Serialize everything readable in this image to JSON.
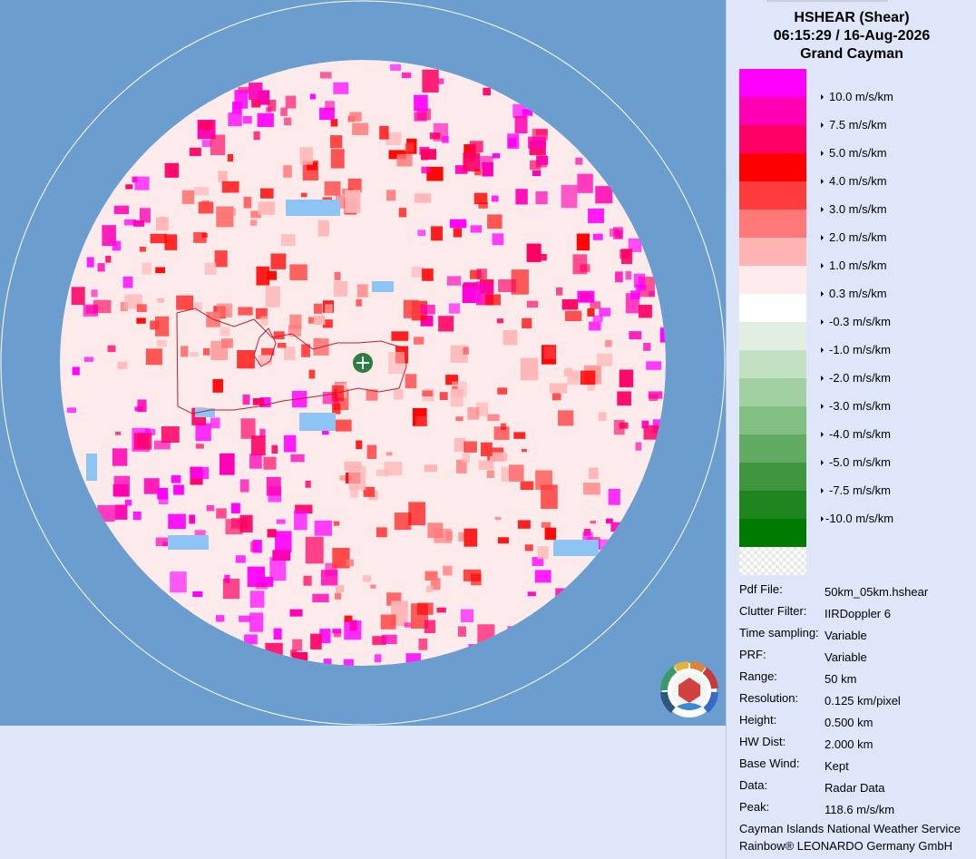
{
  "header": {
    "product": "HSHEAR (Shear)",
    "datetime": "06:15:29 / 16-Aug-2026",
    "site": "Grand Cayman"
  },
  "legend": [
    {
      "label": "10.0 m/s/km",
      "color": "#ff00ff"
    },
    {
      "label": "7.5 m/s/km",
      "color": "#ff00b4"
    },
    {
      "label": "5.0 m/s/km",
      "color": "#ff0064"
    },
    {
      "label": "4.0 m/s/km",
      "color": "#ff0000"
    },
    {
      "label": "3.0 m/s/km",
      "color": "#ff3c3c"
    },
    {
      "label": "2.0 m/s/km",
      "color": "#ff7878"
    },
    {
      "label": "1.0 m/s/km",
      "color": "#ffb4b4"
    },
    {
      "label": "0.3 m/s/km",
      "color": "#fdeaea"
    },
    {
      "label": "-0.3 m/s/km",
      "color": "#ffffff"
    },
    {
      "label": "-1.0 m/s/km",
      "color": "#e2eee2"
    },
    {
      "label": "-2.0 m/s/km",
      "color": "#c2e0c2"
    },
    {
      "label": "-3.0 m/s/km",
      "color": "#a2d0a2"
    },
    {
      "label": "-4.0 m/s/km",
      "color": "#82bf82"
    },
    {
      "label": "-5.0 m/s/km",
      "color": "#62ab62"
    },
    {
      "label": "-7.5 m/s/km",
      "color": "#3f963f"
    },
    {
      "label": "-10.0 m/s/km",
      "color": "#1f851f"
    },
    {
      "label": "",
      "color": "#007a00"
    }
  ],
  "info": [
    {
      "key": "Pdf File:",
      "value": "50km_05km.hshear"
    },
    {
      "key": "Clutter Filter:",
      "value": "IIRDoppler 6"
    },
    {
      "key": "Time sampling:",
      "value": "Variable"
    },
    {
      "key": "PRF:",
      "value": "Variable"
    },
    {
      "key": "Range:",
      "value": "50 km"
    },
    {
      "key": "Resolution:",
      "value": "0.125 km/pixel"
    },
    {
      "key": "Height:",
      "value": "0.500 km"
    },
    {
      "key": "HW Dist:",
      "value": "2.000 km"
    },
    {
      "key": "Base Wind:",
      "value": "Kept"
    },
    {
      "key": "Data:",
      "value": "Radar Data"
    },
    {
      "key": "Peak:",
      "value": "118.6 m/s/km"
    }
  ],
  "footer": {
    "line1": "Cayman Islands National Weather Service",
    "line2": "Rainbow® LEONARDO Germany GmbH"
  },
  "map": {
    "background_color": "#6b9ecf",
    "no_echo_color": "#8ec4f4",
    "radar_site_icon": "radar-site-plus-icon",
    "logo_icon": "cayman-weather-service-logo"
  }
}
